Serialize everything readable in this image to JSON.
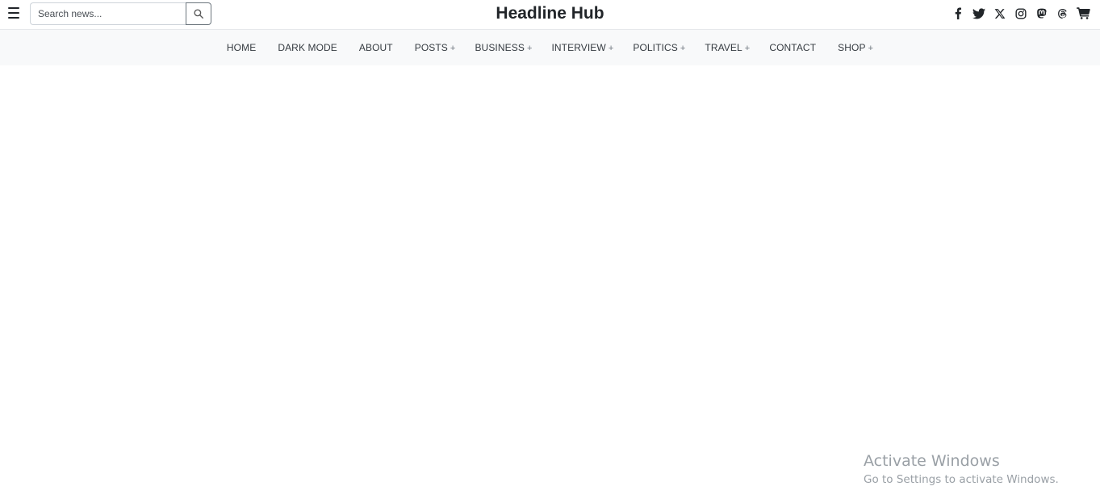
{
  "header": {
    "title": "Headline Hub",
    "search": {
      "placeholder": "Search news...",
      "value": ""
    },
    "social_icons": [
      "facebook-icon",
      "twitter-icon",
      "x-icon",
      "instagram-icon",
      "mastodon-icon",
      "threads-icon",
      "cart-icon"
    ]
  },
  "nav": {
    "items": [
      {
        "label": "HOME",
        "dropdown": ""
      },
      {
        "label": "DARK MODE",
        "dropdown": ""
      },
      {
        "label": "ABOUT",
        "dropdown": ""
      },
      {
        "label": "POSTS",
        "dropdown": "+"
      },
      {
        "label": "BUSINESS",
        "dropdown": "+"
      },
      {
        "label": "INTERVIEW",
        "dropdown": "+"
      },
      {
        "label": "POLITICS",
        "dropdown": "+"
      },
      {
        "label": "TRAVEL",
        "dropdown": "+"
      },
      {
        "label": "CONTACT",
        "dropdown": ""
      },
      {
        "label": "SHOP",
        "dropdown": "+"
      }
    ]
  },
  "watermark": {
    "title": "Activate Windows",
    "subtitle": "Go to Settings to activate Windows."
  }
}
